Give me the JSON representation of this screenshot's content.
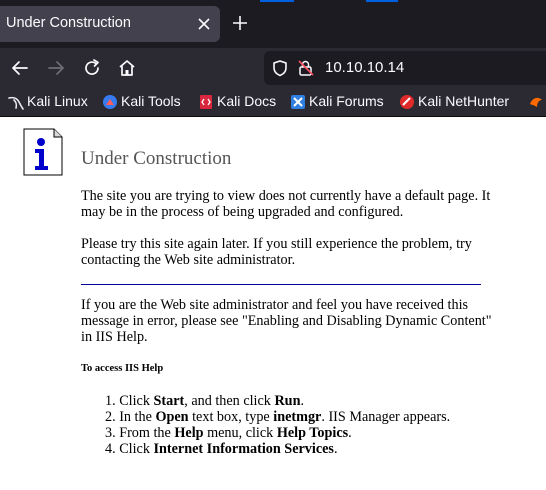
{
  "browser": {
    "tab": {
      "title": "Under Construction"
    },
    "url": "10.10.10.14",
    "bookmarks": [
      {
        "label": "Kali Linux",
        "icon": "kali-dragon-icon"
      },
      {
        "label": "Kali Tools",
        "icon": "kali-tools-icon"
      },
      {
        "label": "Kali Docs",
        "icon": "kali-docs-icon"
      },
      {
        "label": "Kali Forums",
        "icon": "kali-forums-icon"
      },
      {
        "label": "Kali NetHunter",
        "icon": "kali-nethunter-icon"
      }
    ],
    "colors": {
      "tabbar": "#1c1b22",
      "toolbar": "#2b2a33",
      "tab": "#42414d",
      "accent": "#0060df"
    }
  },
  "page": {
    "heading": "Under Construction",
    "para1": "The site you are trying to view does not currently have a default page. It may be in the process of being upgraded and configured.",
    "para2": "Please try this site again later. If you still experience the problem, try contacting the Web site administrator.",
    "para3": "If you are the Web site administrator and feel you have received this message in error, please see \"Enabling and Disabling Dynamic Content\" in IIS Help.",
    "help_heading": "To access IIS Help",
    "steps": [
      {
        "pre": "Click ",
        "b1": "Start",
        "mid": ", and then click ",
        "b2": "Run",
        "post": "."
      },
      {
        "pre": "In the ",
        "b1": "Open",
        "mid": " text box, type ",
        "b2": "inetmgr",
        "post": ". IIS Manager appears."
      },
      {
        "pre": "From the ",
        "b1": "Help",
        "mid": " menu, click ",
        "b2": "Help Topics",
        "post": "."
      },
      {
        "pre": "Click ",
        "b1": "Internet Information Services",
        "mid": "",
        "b2": "",
        "post": "."
      }
    ],
    "colors": {
      "heading": "#555555",
      "rule": "#000099",
      "icon": "#0000cc"
    }
  }
}
